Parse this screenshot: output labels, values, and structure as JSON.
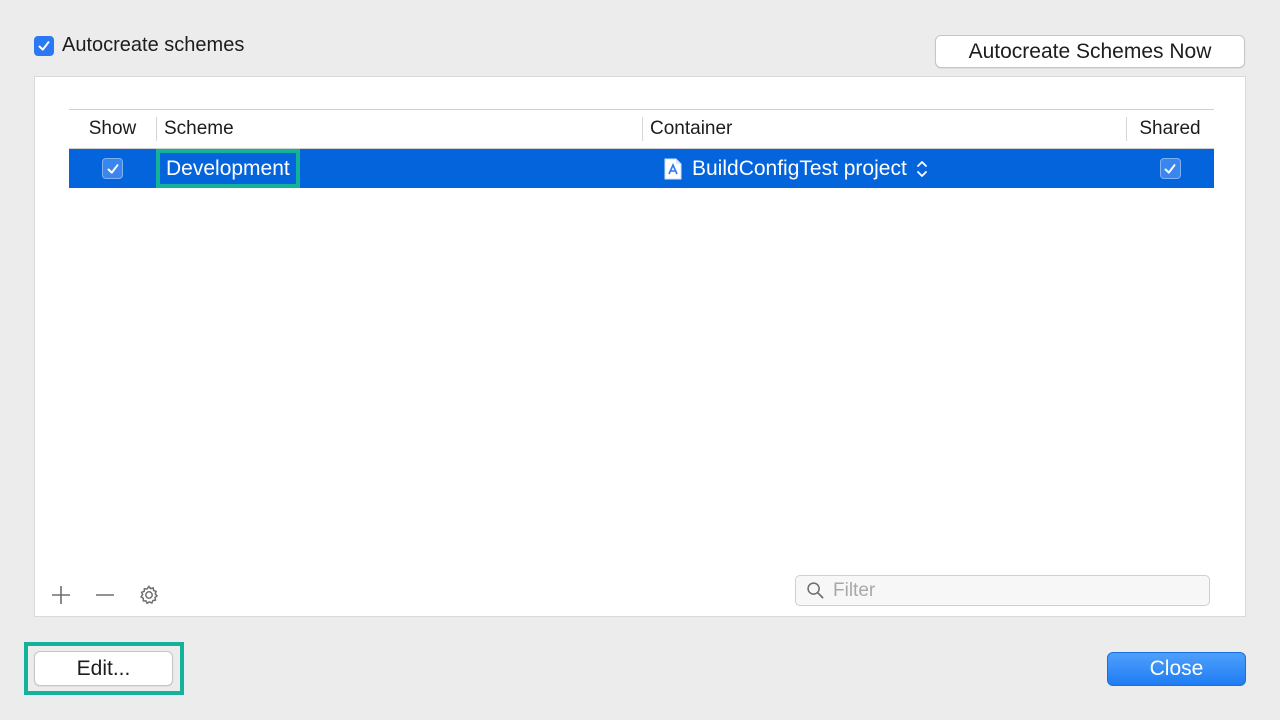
{
  "autocreate": {
    "label": "Autocreate schemes",
    "checked": true
  },
  "buttons": {
    "autocreate_now": "Autocreate Schemes Now",
    "edit": "Edit...",
    "close": "Close"
  },
  "table": {
    "headers": {
      "show": "Show",
      "scheme": "Scheme",
      "container": "Container",
      "shared": "Shared"
    },
    "rows": [
      {
        "show": true,
        "scheme": "Development",
        "container": "BuildConfigTest project",
        "shared": true
      }
    ]
  },
  "filter": {
    "placeholder": "Filter",
    "value": ""
  },
  "icons": {
    "add": "plus-icon",
    "remove": "minus-icon",
    "settings": "gear-icon",
    "search": "search-icon",
    "project": "project-file-icon",
    "stepper": "updown-chevron-icon"
  },
  "colors": {
    "selection": "#0464dc",
    "accent": "#2b78f4",
    "highlight": "#13b29a"
  }
}
